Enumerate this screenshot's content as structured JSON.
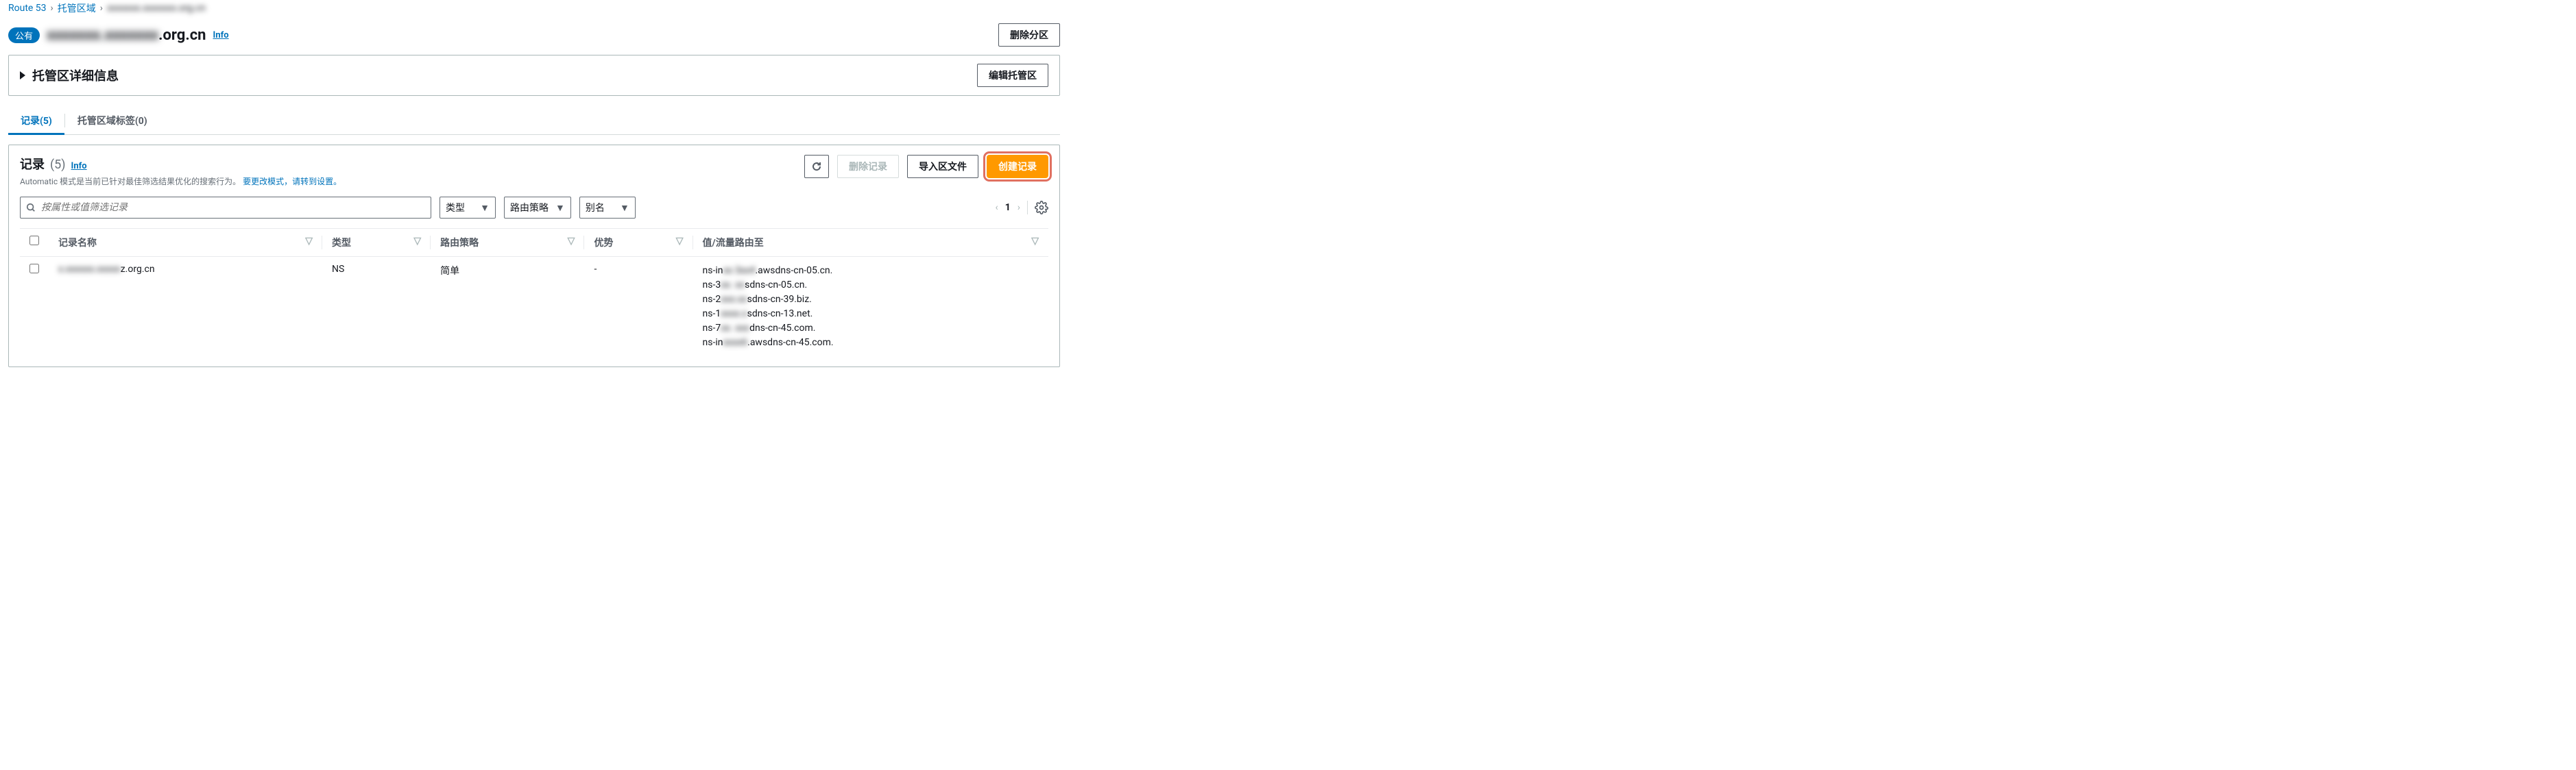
{
  "breadcrumb": {
    "root": "Route 53",
    "hosted_zones": "托管区域",
    "current": "xxxxxxx.xxxxxxx.org.cn"
  },
  "header": {
    "badge": "公有",
    "zone_name_prefix": "xxxxxxx.xxxxxxx",
    "zone_name_suffix": ".org.cn",
    "info": "Info",
    "delete_partition": "删除分区"
  },
  "details": {
    "title": "托管区详细信息",
    "edit": "编辑托管区"
  },
  "tabs": {
    "records": "记录(5)",
    "tags": "托管区域标签(0)"
  },
  "records_section": {
    "title": "记录",
    "count": "(5)",
    "info": "Info",
    "subtitle_prefix": "Automatic 模式是当前已针对最佳筛选结果优化的搜索行为。",
    "subtitle_link": "要更改模式，请转到设置。",
    "delete_record": "删除记录",
    "import_zone": "导入区文件",
    "create_record": "创建记录"
  },
  "filters": {
    "search_placeholder": "按属性或值筛选记录",
    "type": "类型",
    "routing": "路由策略",
    "alias": "别名",
    "page": "1"
  },
  "columns": {
    "name": "记录名称",
    "type": "类型",
    "routing": "路由策略",
    "weight": "优势",
    "value": "值/流量路由至"
  },
  "rows": [
    {
      "name_blur": "x.xxxxxx.xxxxx",
      "name_suffix": "z.org.cn",
      "type": "NS",
      "routing": "简单",
      "weight": "-",
      "values": [
        {
          "pre": "ns-in",
          "blur": "xx 3xx4",
          "post": ".awsdns-cn-05.cn."
        },
        {
          "pre": "ns-3",
          "blur": "xx. xx",
          "post": "sdns-cn-05.cn."
        },
        {
          "pre": "ns-2",
          "blur": "xxx.xx",
          "post": "sdns-cn-39.biz."
        },
        {
          "pre": "ns-1",
          "blur": "xxxx.x",
          "post": "sdns-cn-13.net."
        },
        {
          "pre": "ns-7",
          "blur": "xx. xxx",
          "post": "dns-cn-45.com."
        },
        {
          "pre": "ns-in",
          "blur": "xxxx6",
          "post": ".awsdns-cn-45.com."
        }
      ]
    }
  ]
}
